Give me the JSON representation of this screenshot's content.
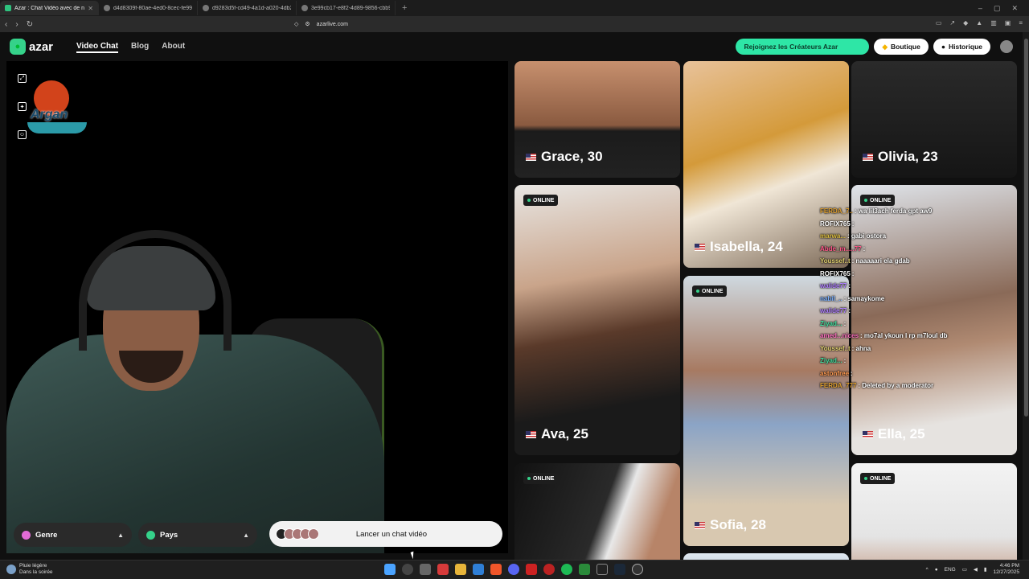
{
  "browser": {
    "tabs": [
      {
        "title": "Azar : Chat Vidéo avec de no",
        "active": true
      },
      {
        "title": "d4d8309f-80ae-4ed0-8cec-fe9942e7",
        "active": false
      },
      {
        "title": "d9283d5f-cd49-4a1d-a020-4db20b5",
        "active": false
      },
      {
        "title": "3e99cb17-e8f2-4d89-9856-cbb91d1",
        "active": false
      }
    ],
    "url": "azarlive.com"
  },
  "header": {
    "logo_text": "azar",
    "nav": [
      "Video Chat",
      "Blog",
      "About"
    ],
    "creators_button": "Rejoignez les Créateurs Azar",
    "shop_button": "Boutique",
    "history_button": "Historique"
  },
  "overlay_logo_text": "Argan",
  "controls": {
    "gender_label": "Genre",
    "country_label": "Pays",
    "launch_label": "Lancer un chat vidéo"
  },
  "cards": {
    "online_label": "ONLINE",
    "grace": "Grace, 30",
    "isabella": "Isabella, 24",
    "olivia": "Olivia, 23",
    "ava": "Ava, 25",
    "ella": "Ella, 25",
    "sofia": "Sofia, 28"
  },
  "chat": [
    {
      "user": "FERDA_7..",
      "msg": ": wa lil3ach ferda gpt aw9",
      "color": "#e0a030"
    },
    {
      "user": "ROFIX765",
      "msg": ":",
      "color": "#ffffff"
    },
    {
      "user": "marwa...",
      "msg": ": gabi ostora",
      "color": "#e0c040"
    },
    {
      "user": "Abde_m.....77",
      "msg": ":",
      "color": "#ff5a8a"
    },
    {
      "user": "Youssef..t",
      "msg": ": naaaaari ela gdab",
      "color": "#e0d070"
    },
    {
      "user": "ROFIX765",
      "msg": ":",
      "color": "#ffffff"
    },
    {
      "user": "walide77",
      "msg": ":",
      "color": "#b080ff"
    },
    {
      "user": "nabil_..",
      "msg": ": samaykome",
      "color": "#7ab0ff"
    },
    {
      "user": "walide77",
      "msg": ":",
      "color": "#b080ff"
    },
    {
      "user": "Ziyad...",
      "msg": ":",
      "color": "#40e0a0"
    },
    {
      "user": "amed...nices",
      "msg": ": mo7al ykoun l rp m7loul db",
      "color": "#ff70c0"
    },
    {
      "user": "Youssef..t",
      "msg": ": ahna",
      "color": "#e0d070"
    },
    {
      "user": "Ziyad...",
      "msg": ":",
      "color": "#40e0a0"
    },
    {
      "user": "astonfree",
      "msg": ":",
      "color": "#ff9a50"
    },
    {
      "user": "FERDA_777",
      "msg": ": Deleted by a moderator",
      "color": "#e0a030"
    }
  ],
  "taskbar": {
    "weather_title": "Pluie légère",
    "weather_sub": "Dans la soirée",
    "lang": "ENG",
    "time": "4:46 PM",
    "date": "12/27/2025"
  },
  "colors": {
    "accent_green": "#2ee6a6",
    "online_dot": "#35d28a"
  }
}
